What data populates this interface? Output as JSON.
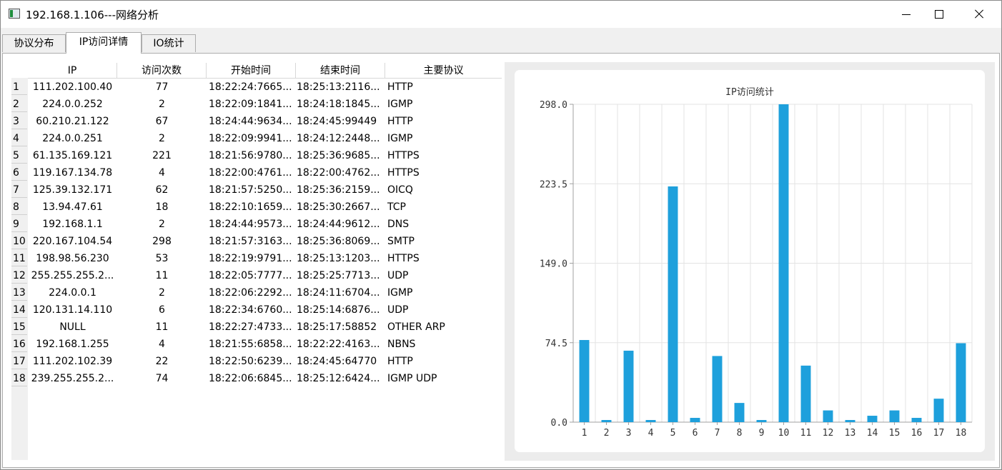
{
  "window": {
    "title": "192.168.1.106---网络分析"
  },
  "tabs": [
    {
      "label": "协议分布"
    },
    {
      "label": "IP访问详情"
    },
    {
      "label": "IO统计"
    }
  ],
  "table": {
    "columns": [
      "IP",
      "访问次数",
      "开始时间",
      "结束时间",
      "主要协议"
    ],
    "rows": [
      [
        "1",
        "111.202.100.40",
        "77",
        "18:22:24:7665...",
        "18:25:13:2116...",
        "HTTP"
      ],
      [
        "2",
        "224.0.0.252",
        "2",
        "18:22:09:1841...",
        "18:24:18:1845...",
        "IGMP"
      ],
      [
        "3",
        "60.210.21.122",
        "67",
        "18:24:44:9634...",
        "18:24:45:99449",
        "HTTP"
      ],
      [
        "4",
        "224.0.0.251",
        "2",
        "18:22:09:9941...",
        "18:24:12:2448...",
        "IGMP"
      ],
      [
        "5",
        "61.135.169.121",
        "221",
        "18:21:56:9780...",
        "18:25:36:9685...",
        "HTTPS"
      ],
      [
        "6",
        "119.167.134.78",
        "4",
        "18:22:00:4761...",
        "18:22:00:4762...",
        "HTTPS"
      ],
      [
        "7",
        "125.39.132.171",
        "62",
        "18:21:57:5250...",
        "18:25:36:2159...",
        "OICQ"
      ],
      [
        "8",
        "13.94.47.61",
        "18",
        "18:22:10:1659...",
        "18:25:30:2667...",
        "TCP"
      ],
      [
        "9",
        "192.168.1.1",
        "2",
        "18:24:44:9573...",
        "18:24:44:9612...",
        "DNS"
      ],
      [
        "10",
        "220.167.104.54",
        "298",
        "18:21:57:3163...",
        "18:25:36:8069...",
        "SMTP"
      ],
      [
        "11",
        "198.98.56.230",
        "53",
        "18:22:19:9791...",
        "18:25:13:1203...",
        "HTTPS"
      ],
      [
        "12",
        "255.255.255.2...",
        "11",
        "18:22:05:7777...",
        "18:25:25:7713...",
        "UDP"
      ],
      [
        "13",
        "224.0.0.1",
        "2",
        "18:22:06:2292...",
        "18:24:11:6704...",
        "IGMP"
      ],
      [
        "14",
        "120.131.14.110",
        "6",
        "18:22:34:6760...",
        "18:25:14:6876...",
        "UDP"
      ],
      [
        "15",
        "NULL",
        "11",
        "18:22:27:4733...",
        "18:25:17:58852",
        "OTHER ARP"
      ],
      [
        "16",
        "192.168.1.255",
        "4",
        "18:21:55:6858...",
        "18:22:22:4163...",
        "NBNS"
      ],
      [
        "17",
        "111.202.102.39",
        "22",
        "18:22:50:6239...",
        "18:24:45:64770",
        "HTTP"
      ],
      [
        "18",
        "239.255.255.2...",
        "74",
        "18:22:06:6845...",
        "18:25:12:6424...",
        "IGMP UDP"
      ]
    ]
  },
  "chart_data": {
    "type": "bar",
    "title": "IP访问统计",
    "categories": [
      "1",
      "2",
      "3",
      "4",
      "5",
      "6",
      "7",
      "8",
      "9",
      "10",
      "11",
      "12",
      "13",
      "14",
      "15",
      "16",
      "17",
      "18"
    ],
    "values": [
      77,
      2,
      67,
      2,
      221,
      4,
      62,
      18,
      2,
      298,
      53,
      11,
      2,
      6,
      11,
      4,
      22,
      74
    ],
    "ylim": [
      0,
      298
    ],
    "yticks": [
      "0.0",
      "74.5",
      "149.0",
      "223.5",
      "298.0"
    ],
    "grid": true,
    "bar_color": "#1ea0dc"
  }
}
